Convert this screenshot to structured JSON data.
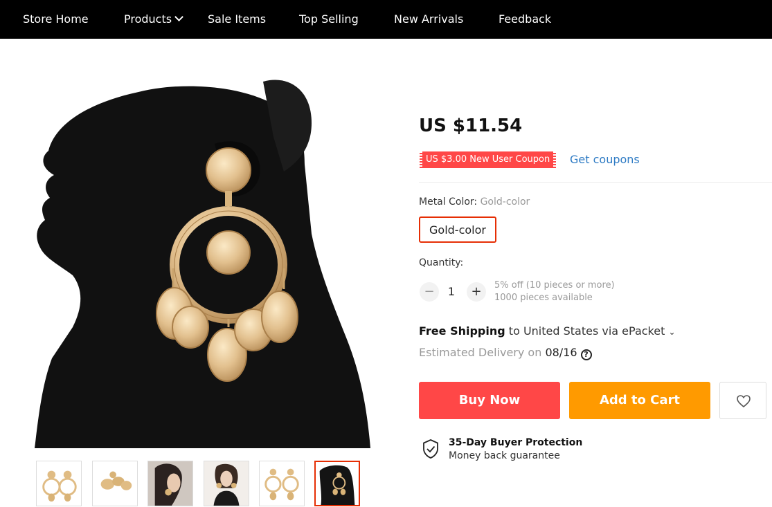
{
  "nav": {
    "items": [
      {
        "label": "Store Home"
      },
      {
        "label": "Products"
      },
      {
        "label": "Sale Items"
      },
      {
        "label": "Top Selling"
      },
      {
        "label": "New Arrivals"
      },
      {
        "label": "Feedback"
      }
    ]
  },
  "product": {
    "price": "US $11.54",
    "coupon_badge": "US $3.00 New User Coupon",
    "get_coupons": "Get coupons",
    "sku": {
      "title": "Metal Color:",
      "selected": "Gold-color",
      "options": [
        "Gold-color"
      ]
    },
    "quantity": {
      "title": "Quantity:",
      "value": "1",
      "minus": "−",
      "plus": "+",
      "discount_note": "5% off (10 pieces or more)",
      "available_note": "1000 pieces available"
    },
    "shipping": {
      "free": "Free Shipping",
      "destination": "to United States via ePacket",
      "estimate_label": "Estimated Delivery on",
      "estimate_date": "08/16"
    },
    "buttons": {
      "buy_now": "Buy Now",
      "add_to_cart": "Add to Cart"
    },
    "protection": {
      "title": "35-Day Buyer Protection",
      "subtitle": "Money back guarantee"
    }
  },
  "gallery": {
    "thumbnail_count": 6,
    "active_index": 5
  },
  "colors": {
    "nav_bg": "#000000",
    "buy_now": "#ff4747",
    "add_to_cart": "#ff9a00",
    "accent_red": "#e62e04",
    "link_blue": "#2e7bc4"
  },
  "icons": [
    "chevron-down-icon",
    "help-icon",
    "heart-icon",
    "shield-check-icon"
  ]
}
